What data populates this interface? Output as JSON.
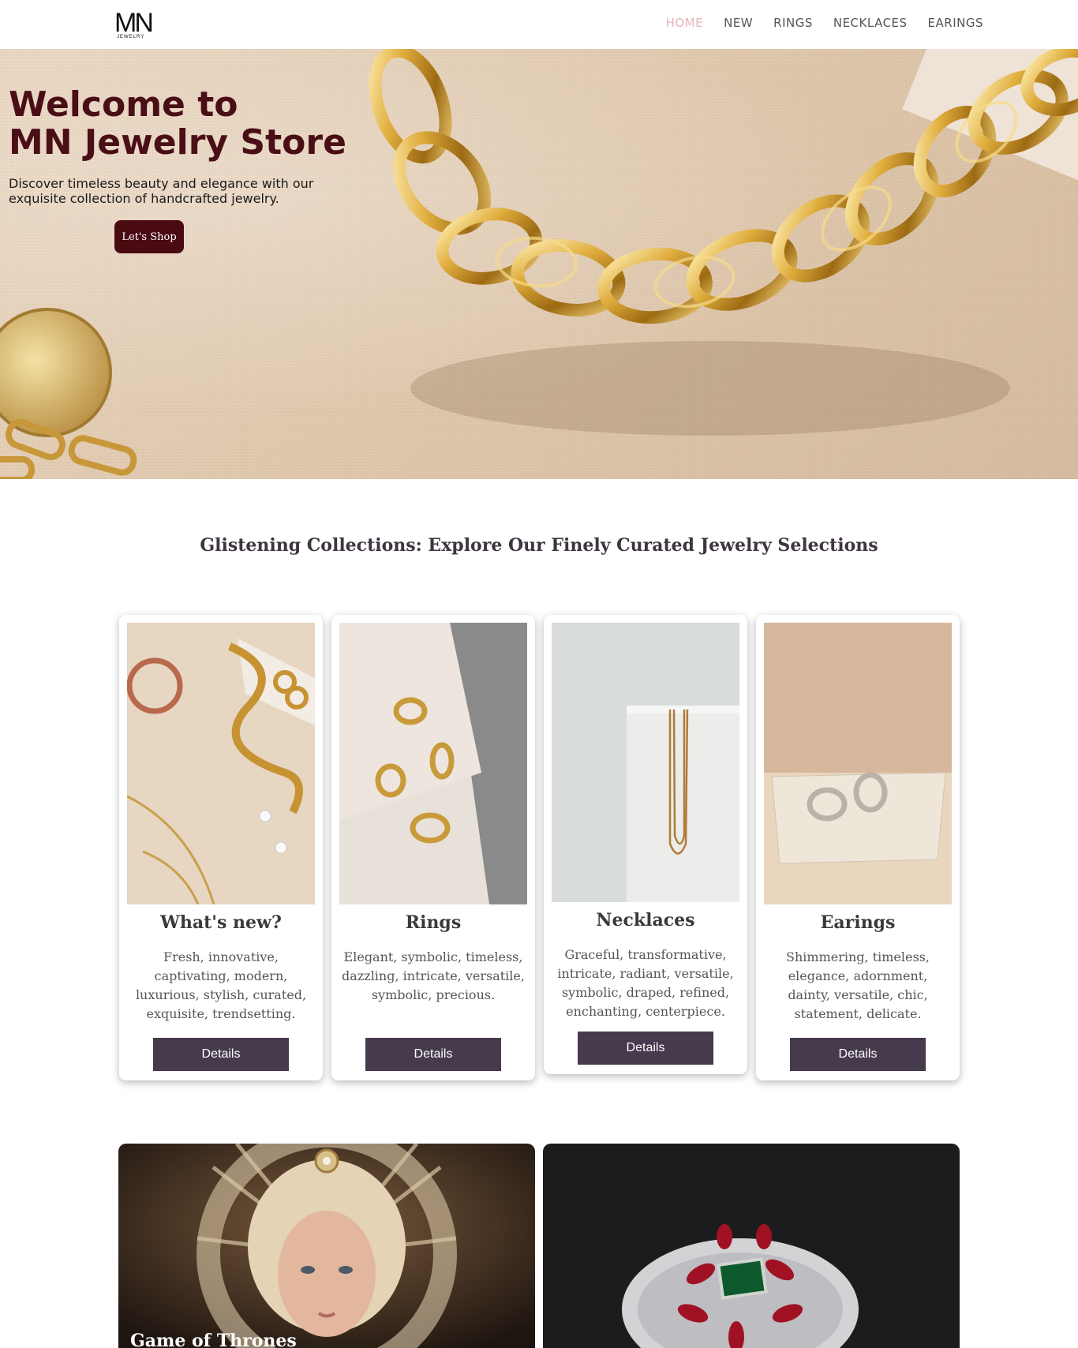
{
  "brand": {
    "logo_text": "MN",
    "logo_sub": "JEWELRY"
  },
  "nav": {
    "items": [
      {
        "label": "HOME",
        "active": true
      },
      {
        "label": "NEW",
        "active": false
      },
      {
        "label": "RINGS",
        "active": false
      },
      {
        "label": "NECKLACES",
        "active": false
      },
      {
        "label": "EARINGS",
        "active": false
      }
    ],
    "active_color": "#e8b4b8"
  },
  "hero": {
    "title_line1": "Welcome to",
    "title_line2": "MN Jewelry Store",
    "subtitle": "Discover timeless beauty and elegance with our exquisite collection of handcrafted jewelry.",
    "cta_label": "Let's Shop"
  },
  "collections": {
    "title": "Glistening Collections: Explore Our Finely Curated Jewelry Selections",
    "cards": [
      {
        "name": "What's new?",
        "description": "Fresh, innovative, captivating, modern, luxurious, stylish, curated, exquisite, trendsetting.",
        "button": "Details"
      },
      {
        "name": "Rings",
        "description": "Elegant, symbolic, timeless, dazzling, intricate, versatile, symbolic, precious.",
        "button": "Details"
      },
      {
        "name": "Necklaces",
        "description": "Graceful, transformative, intricate, radiant, versatile, symbolic, draped, refined, enchanting, centerpiece.",
        "button": "Details"
      },
      {
        "name": "Earings",
        "description": "Shimmering, timeless, elegance, adornment, dainty, versatile, chic, statement, delicate.",
        "button": "Details"
      }
    ]
  },
  "banners": [
    {
      "title": "Game of Thrones"
    },
    {
      "title": ""
    }
  ],
  "colors": {
    "hero_title": "#4a0e16",
    "hero_button": "#4a0a12",
    "details_button": "#463a4d",
    "section_title": "#3e3540"
  }
}
